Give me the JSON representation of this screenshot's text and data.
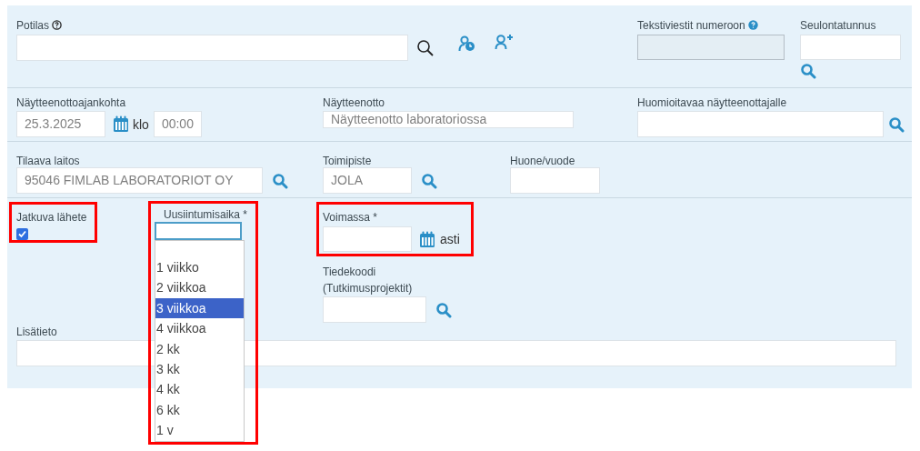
{
  "patient": {
    "label": "Potilas"
  },
  "sms": {
    "label": "Tekstiviestit numeroon",
    "disabled": true
  },
  "screening": {
    "label": "Seulontatunnus"
  },
  "sample_time": {
    "label": "Näytteenottoajankohta",
    "date": "25.3.2025",
    "klo": "klo",
    "time": "00:00"
  },
  "sampling": {
    "label": "Näytteenotto",
    "value": "Näytteenotto laboratoriossa"
  },
  "notes_for_sampler": {
    "label": "Huomioitavaa näytteenottajalle"
  },
  "ordering_unit": {
    "label": "Tilaava laitos",
    "value": "95046 FIMLAB LABORATORIOT OY"
  },
  "office": {
    "label": "Toimipiste",
    "value": "JOLA"
  },
  "room": {
    "label": "Huone/vuode"
  },
  "continuous": {
    "label": "Jatkuva lähete",
    "checked": true
  },
  "recurrence": {
    "label": "Uusiintumisaika *",
    "expanded": true,
    "options": [
      {
        "label": "1 viikko",
        "selected": false
      },
      {
        "label": "2 viikkoa",
        "selected": false
      },
      {
        "label": "3 viikkoa",
        "selected": true
      },
      {
        "label": "4 viikkoa",
        "selected": false
      },
      {
        "label": "2 kk",
        "selected": false
      },
      {
        "label": "3 kk",
        "selected": false
      },
      {
        "label": "4 kk",
        "selected": false
      },
      {
        "label": "6 kk",
        "selected": false
      },
      {
        "label": "1 v",
        "selected": false
      }
    ]
  },
  "valid": {
    "label": "Voimassa *",
    "suffix": "asti"
  },
  "science_code": {
    "label": "Tiedekoodi",
    "sublabel": "(Tutkimusprojektit)"
  },
  "extra": {
    "label": "Lisätieto"
  }
}
